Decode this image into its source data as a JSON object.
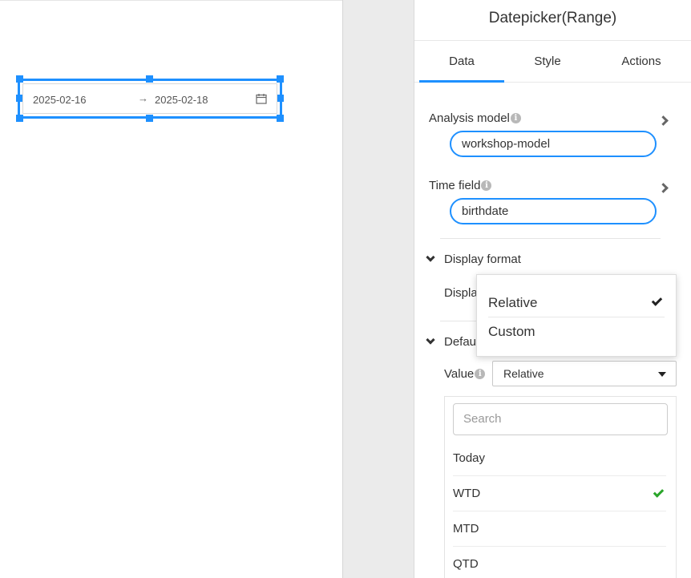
{
  "canvas": {
    "date_range": {
      "start": "2025-02-16",
      "separator": "→",
      "end": "2025-02-18"
    }
  },
  "panel": {
    "title": "Datepicker(Range)",
    "tabs": [
      {
        "label": "Data",
        "active": true
      },
      {
        "label": "Style",
        "active": false
      },
      {
        "label": "Actions",
        "active": false
      }
    ],
    "analysis_model": {
      "label": "Analysis model",
      "value": "workshop-model"
    },
    "time_field": {
      "label": "Time field",
      "value": "birthdate"
    },
    "display_format": {
      "section_label": "Display format",
      "field_label_visible": "Displa",
      "options": [
        {
          "label": "Relative",
          "selected": true
        },
        {
          "label": "Custom",
          "selected": false
        }
      ]
    },
    "default_section": {
      "section_label_visible": "Defau",
      "value_label": "Value",
      "value_selected": "Relative",
      "search_placeholder": "Search",
      "options": [
        {
          "label": "Today",
          "selected": false
        },
        {
          "label": "WTD",
          "selected": true
        },
        {
          "label": "MTD",
          "selected": false
        },
        {
          "label": "QTD",
          "selected": false
        }
      ]
    }
  },
  "colors": {
    "accent": "#1e90ff",
    "check_green": "#2aa52a",
    "gutter": "#ebebeb"
  }
}
